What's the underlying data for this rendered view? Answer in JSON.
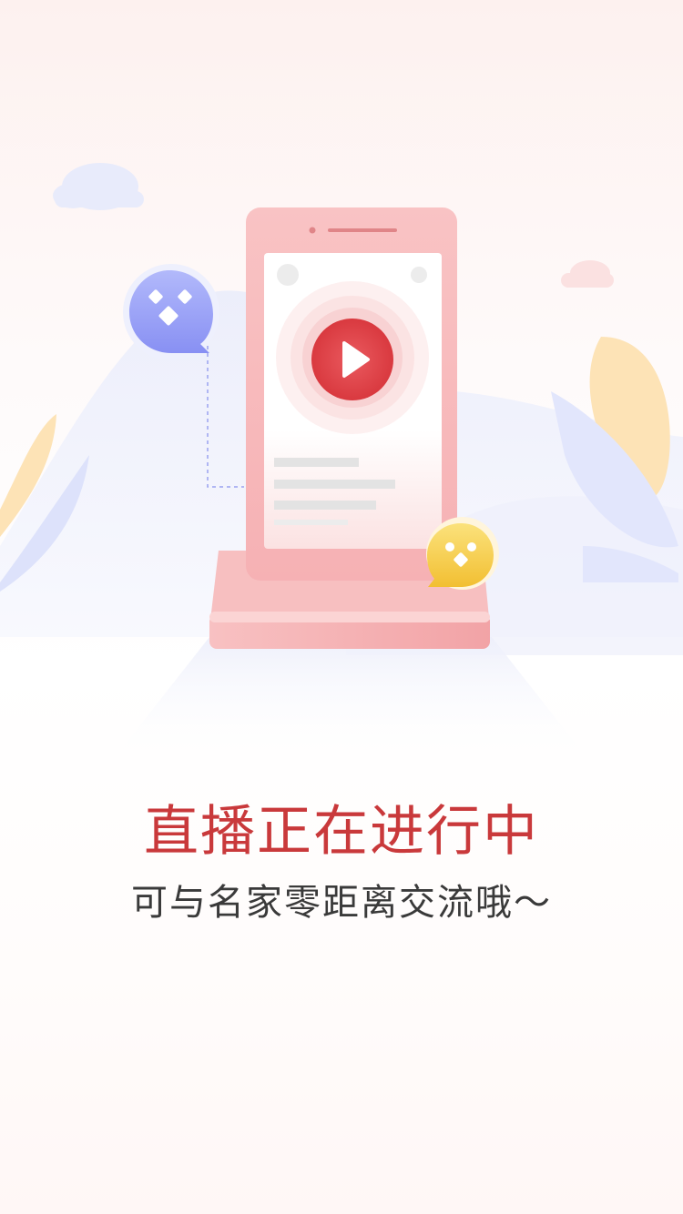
{
  "headline": "直播正在进行中",
  "subheadline": "可与名家零距离交流哦～",
  "colors": {
    "headline": "#c9393b",
    "subheadline": "#3a3a3a",
    "phone": "#f7b7b9",
    "play_button": "#e0484d",
    "bubble_blue": "#8f99f5",
    "bubble_yellow": "#f4c542"
  },
  "icons": [
    "play-icon",
    "chat-bubble-blue-icon",
    "chat-bubble-yellow-icon",
    "cloud-icon",
    "leaf-icon"
  ]
}
